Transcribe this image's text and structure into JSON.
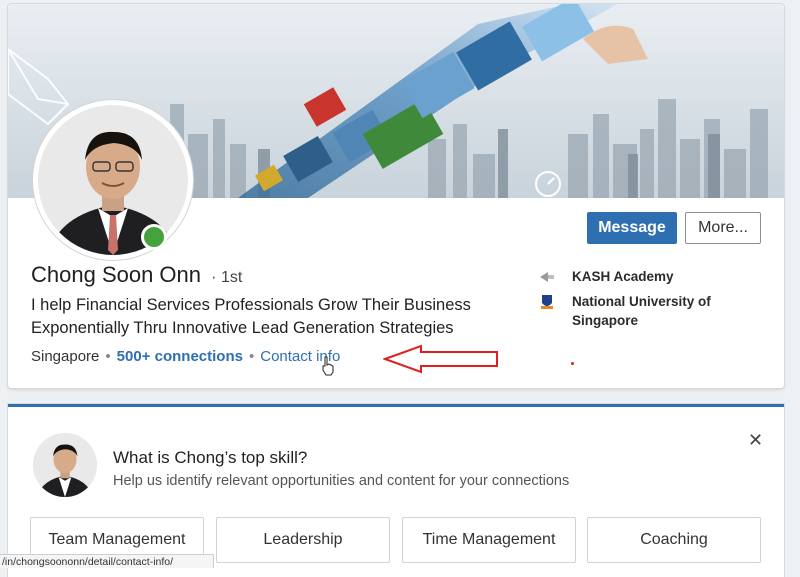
{
  "profile": {
    "name": "Chong Soon Onn",
    "degree": "1st",
    "headline_line1": "I help Financial Services Professionals Grow Their Business",
    "headline_line2": "Exponentially Thru Innovative Lead Generation Strategies",
    "location": "Singapore",
    "connections": "500+ connections",
    "contact_info": "Contact info",
    "online_color": "#45a33e"
  },
  "actions": {
    "message_label": "Message",
    "more_label": "More..."
  },
  "organizations": [
    {
      "name": "KASH Academy",
      "icon": "kash-academy-logo"
    },
    {
      "name": "National University of Singapore",
      "icon": "nus-logo"
    }
  ],
  "skills_prompt": {
    "question": "What is Chong’s top skill?",
    "subtitle": "Help us identify relevant opportunities and content for your connections",
    "skills": [
      "Team Management",
      "Leadership",
      "Time Management",
      "Coaching"
    ]
  },
  "status_url": "/in/chongsoononn/detail/contact-info/",
  "colors": {
    "accent": "#2e6fb2",
    "annotation_arrow": "#e02020"
  }
}
